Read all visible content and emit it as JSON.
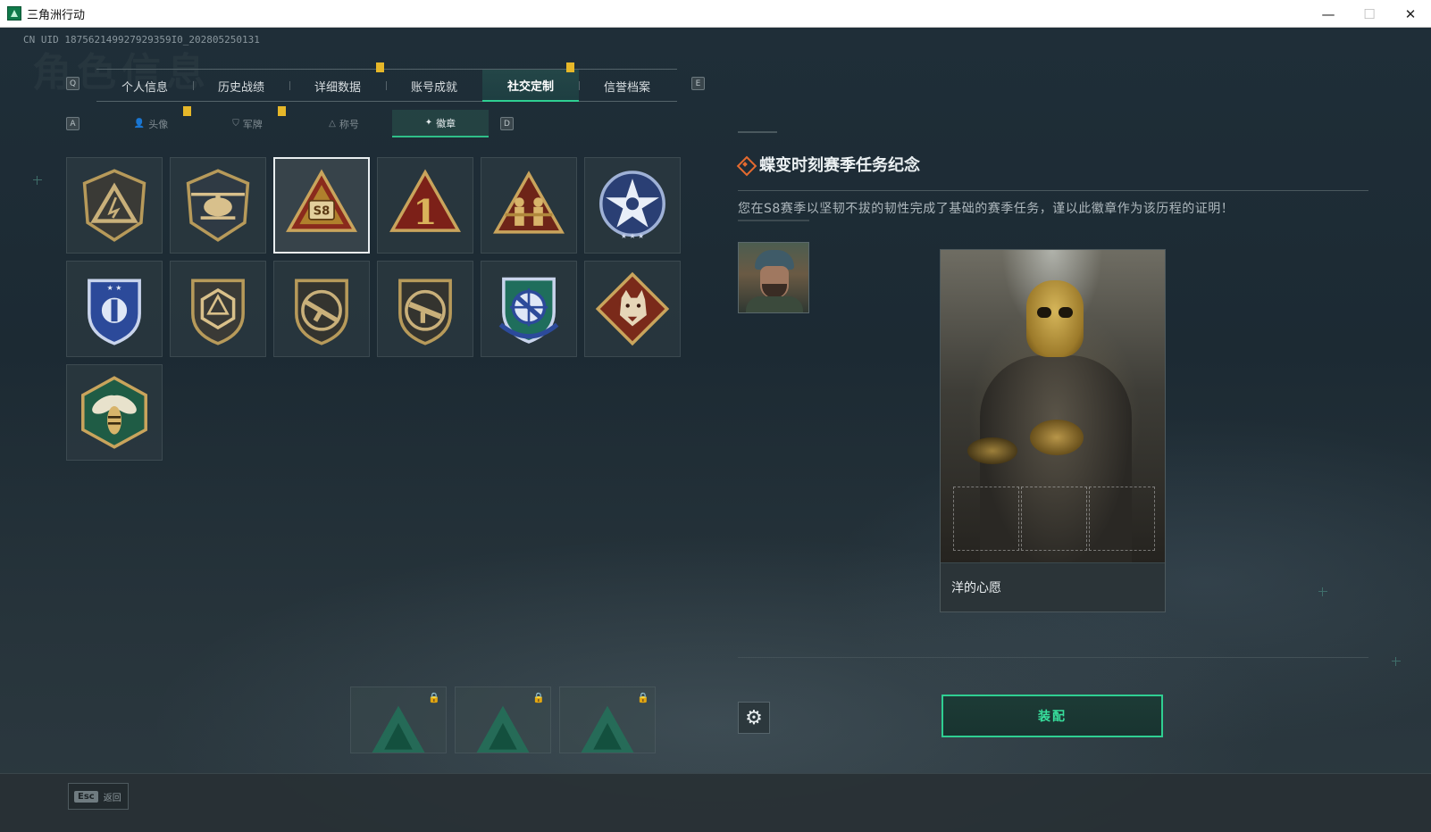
{
  "window": {
    "title": "三角洲行动",
    "minimize_glyph": "—",
    "maximize_glyph": "☐",
    "close_glyph": "✕"
  },
  "header": {
    "uid": "CN UID 187562149927929359I0_202805250131",
    "watermark": "角色信息",
    "prev_key": "Q",
    "next_key": "E"
  },
  "tabs": [
    {
      "label": "个人信息",
      "active": false
    },
    {
      "label": "历史战绩",
      "active": false
    },
    {
      "label": "详细数据",
      "active": false
    },
    {
      "label": "账号成就",
      "active": false
    },
    {
      "label": "社交定制",
      "active": true
    },
    {
      "label": "信誉档案",
      "active": false
    }
  ],
  "subtabs": {
    "prev_key": "A",
    "next_key": "D",
    "items": [
      {
        "label": "头像",
        "icon": "person-icon",
        "active": false
      },
      {
        "label": "军牌",
        "icon": "shield-icon",
        "active": false
      },
      {
        "label": "称号",
        "icon": "triangle-icon",
        "active": false
      },
      {
        "label": "徽章",
        "icon": "wings-icon",
        "active": true
      }
    ]
  },
  "badges": [
    {
      "name": "triangle-emblem",
      "selected": false
    },
    {
      "name": "helicopter-emblem",
      "selected": false
    },
    {
      "name": "s8-triangle-emblem",
      "label": "S8",
      "selected": true
    },
    {
      "name": "number-one-emblem",
      "label": "1",
      "selected": false
    },
    {
      "name": "soldiers-emblem",
      "selected": false
    },
    {
      "name": "blue-star-emblem",
      "selected": false
    },
    {
      "name": "blue-shield-emblem",
      "selected": false
    },
    {
      "name": "gold-hex-emblem",
      "selected": false
    },
    {
      "name": "rifle-shield-emblem",
      "selected": false
    },
    {
      "name": "smg-shield-emblem",
      "selected": false
    },
    {
      "name": "crosshair-shield-emblem",
      "selected": false
    },
    {
      "name": "wolf-diamond-emblem",
      "selected": false
    },
    {
      "name": "wasp-hex-emblem",
      "selected": false
    }
  ],
  "locked_slots": [
    {
      "icon": "lock-icon"
    },
    {
      "icon": "lock-icon"
    },
    {
      "icon": "lock-icon"
    }
  ],
  "detail": {
    "title": "蝶变时刻赛季任务纪念",
    "description": "您在S8赛季以坚韧不拔的韧性完成了基础的赛季任务，谨以此徽章作为该历程的证明！",
    "card_name": "洋的心愿",
    "equip_label": "装配",
    "settings_glyph": "⚙"
  },
  "footer": {
    "esc_key": "Esc",
    "esc_label": "返回"
  },
  "colors": {
    "accent": "#2fcf92",
    "flag": "#e6b729",
    "title_diamond": "#e46a2f"
  }
}
